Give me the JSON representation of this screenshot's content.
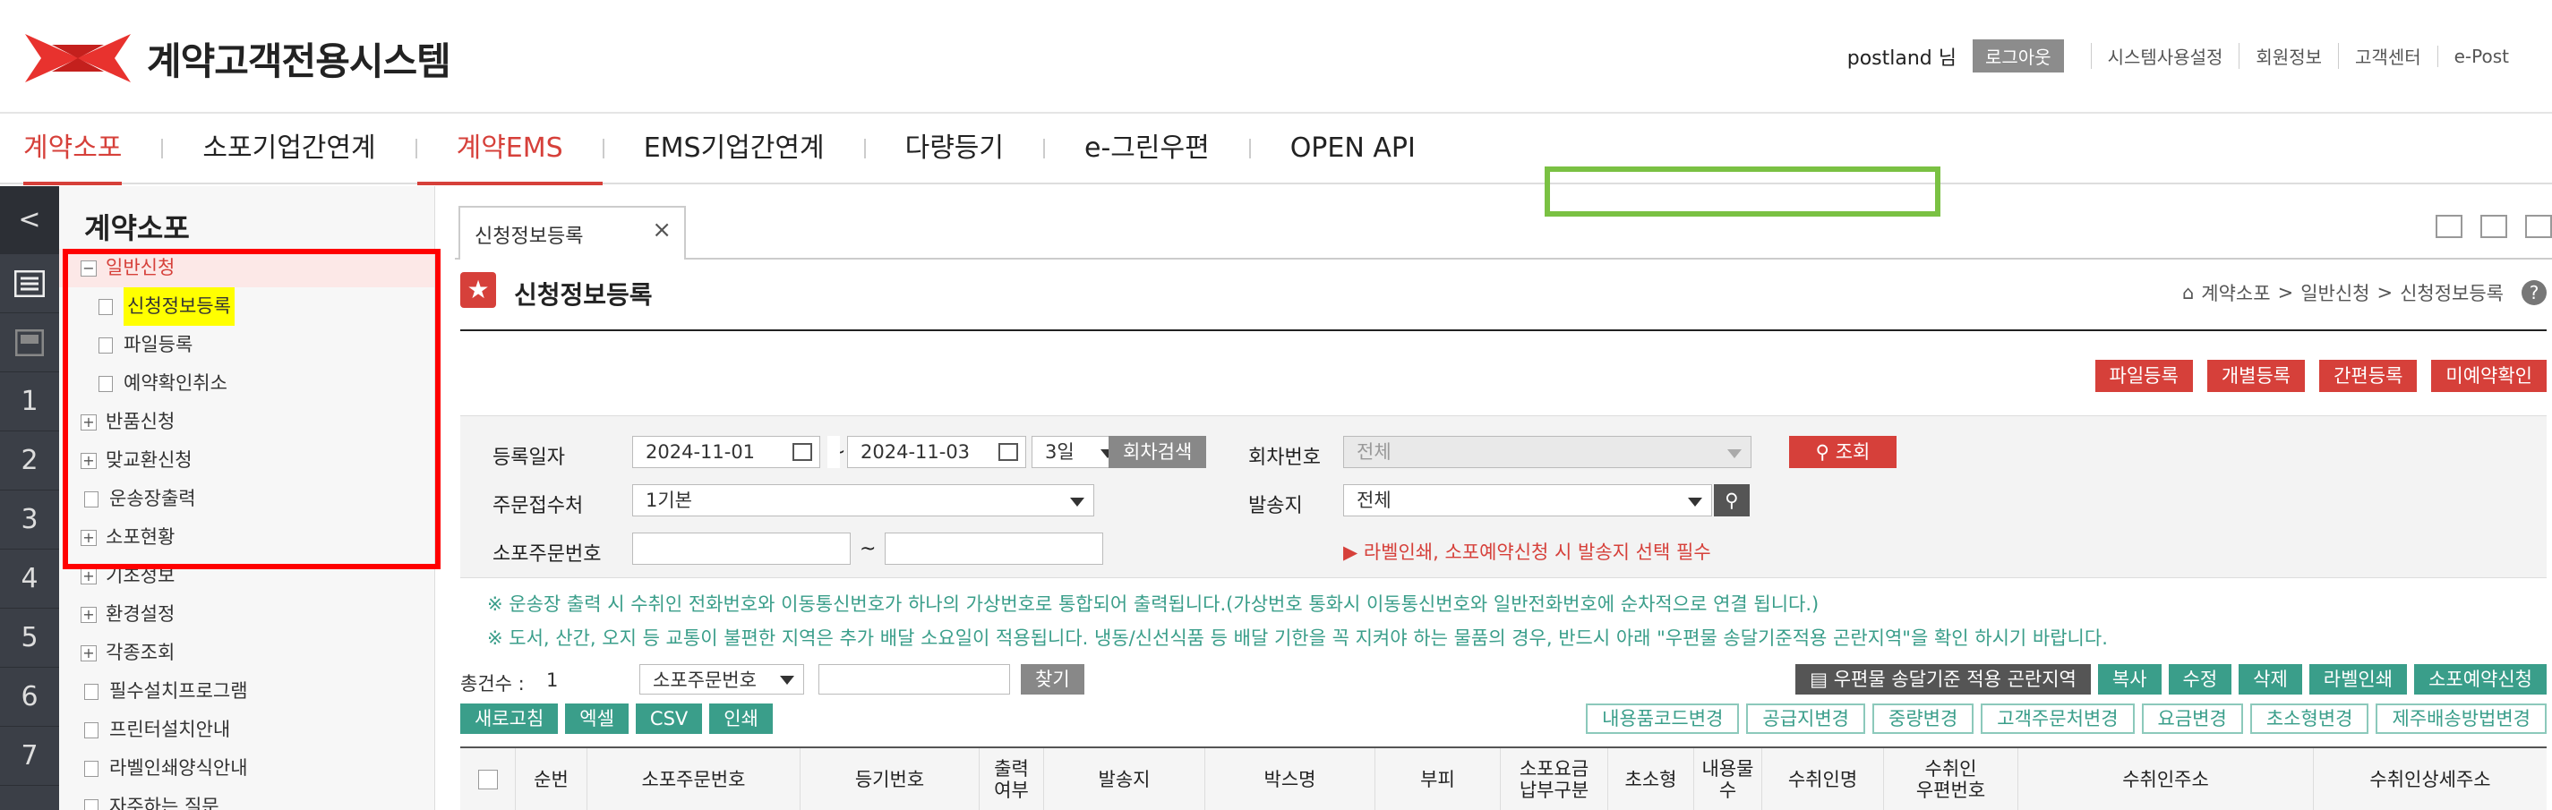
{
  "app": {
    "title": "계약고객전용시스템"
  },
  "util": {
    "user": "postland 님",
    "logout": "로그아웃",
    "links": [
      "시스템사용설정",
      "회원정보",
      "고객센터",
      "e-Post"
    ]
  },
  "gnb": [
    "계약소포",
    "소포기업간연계",
    "계약EMS",
    "EMS기업간연계",
    "다량등기",
    "e-그린우편",
    "OPEN API"
  ],
  "rail": {
    "back": "<",
    "items": [
      "1",
      "2",
      "3",
      "4",
      "5",
      "6",
      "7"
    ]
  },
  "sidebar": {
    "title": "계약소포",
    "items": [
      {
        "label": "일반신청",
        "toggle": "−"
      },
      {
        "label": "신청정보등록"
      },
      {
        "label": "파일등록"
      },
      {
        "label": "예약확인취소"
      },
      {
        "label": "반품신청",
        "toggle": "+"
      },
      {
        "label": "맞교환신청",
        "toggle": "+"
      },
      {
        "label": "운송장출력"
      },
      {
        "label": "소포현황",
        "toggle": "+"
      },
      {
        "label": "기초정보",
        "toggle": "+"
      },
      {
        "label": "환경설정",
        "toggle": "+"
      },
      {
        "label": "각종조회",
        "toggle": "+"
      },
      {
        "label": "필수설치프로그램"
      },
      {
        "label": "프린터설치안내"
      },
      {
        "label": "라벨인쇄양식안내"
      },
      {
        "label": "자주하는 질문"
      }
    ]
  },
  "tab": {
    "label": "신청정보등록",
    "close": "×"
  },
  "page": {
    "title": "신청정보등록",
    "star": "★",
    "breadcrumb": [
      "계약소포",
      ">",
      "일반신청",
      ">",
      "신청정보등록"
    ],
    "help": "?"
  },
  "top_buttons": [
    "파일등록",
    "개별등록",
    "간편등록",
    "미예약확인"
  ],
  "search": {
    "reg_date_label": "등록일자",
    "date_from": "2024-11-01",
    "tilde": "~",
    "date_to": "2024-11-03",
    "period": "3일",
    "round_search": "회차검색",
    "round_label": "회차번호",
    "round_value": "전체",
    "query_button": "조회",
    "order_label": "주문접수처",
    "order_value": "1기본",
    "sender_label": "발송지",
    "sender_value": "전체",
    "parcel_no_label": "소포주문번호",
    "parcel_tilde": "~",
    "warning": "▶ 라벨인쇄, 소포예약신청 시 발송지 선택 필수"
  },
  "notices": [
    "※ 운송장 출력 시 수취인 전화번호와 이동통신번호가 하나의 가상번호로 통합되어 출력됩니다.(가상번호 통화시 이동통신번호와 일반전화번호에 순차적으로 연결 됩니다.)",
    "※ 도서, 산간, 오지 등 교통이 불편한 지역은 추가 배달 소요일이 적용됩니다. 냉동/신선식품 등 배달 기한을 꼭 지켜야 하는 물품의 경우, 반드시 아래 \"우편물 송달기준적용 곤란지역\"을 확인 하시기 바랍니다."
  ],
  "toolbar1": {
    "total_label": "총건수 :",
    "total_count": "1",
    "search_field": "소포주문번호",
    "find_button": "찾기",
    "area_button": "우편물 송달기준 적용 곤란지역",
    "actions": [
      "복사",
      "수정",
      "삭제",
      "라벨인쇄",
      "소포예약신청"
    ]
  },
  "toolbar2": {
    "left": [
      "새로고침",
      "엑셀",
      "CSV",
      "인쇄"
    ],
    "right": [
      "내용품코드변경",
      "공급지변경",
      "중량변경",
      "고객주문처변경",
      "요금변경",
      "초소형변경",
      "제주배송방법변경"
    ]
  },
  "grid_headers": [
    "순번",
    "소포주문번호",
    "등기번호",
    "출력\n여부",
    "발송지",
    "박스명",
    "부피",
    "소포요금\n납부구분",
    "초소형",
    "내용물\n수",
    "수취인명",
    "수취인\n우편번호",
    "수취인주소",
    "수취인상세주소"
  ],
  "colors": {
    "accent": "#d6403a",
    "teal": "#3a9e8a",
    "rail": "#3b3f47",
    "highlight": "#ffff00",
    "red_box": "#ff0000",
    "green_box": "#7ac143"
  }
}
